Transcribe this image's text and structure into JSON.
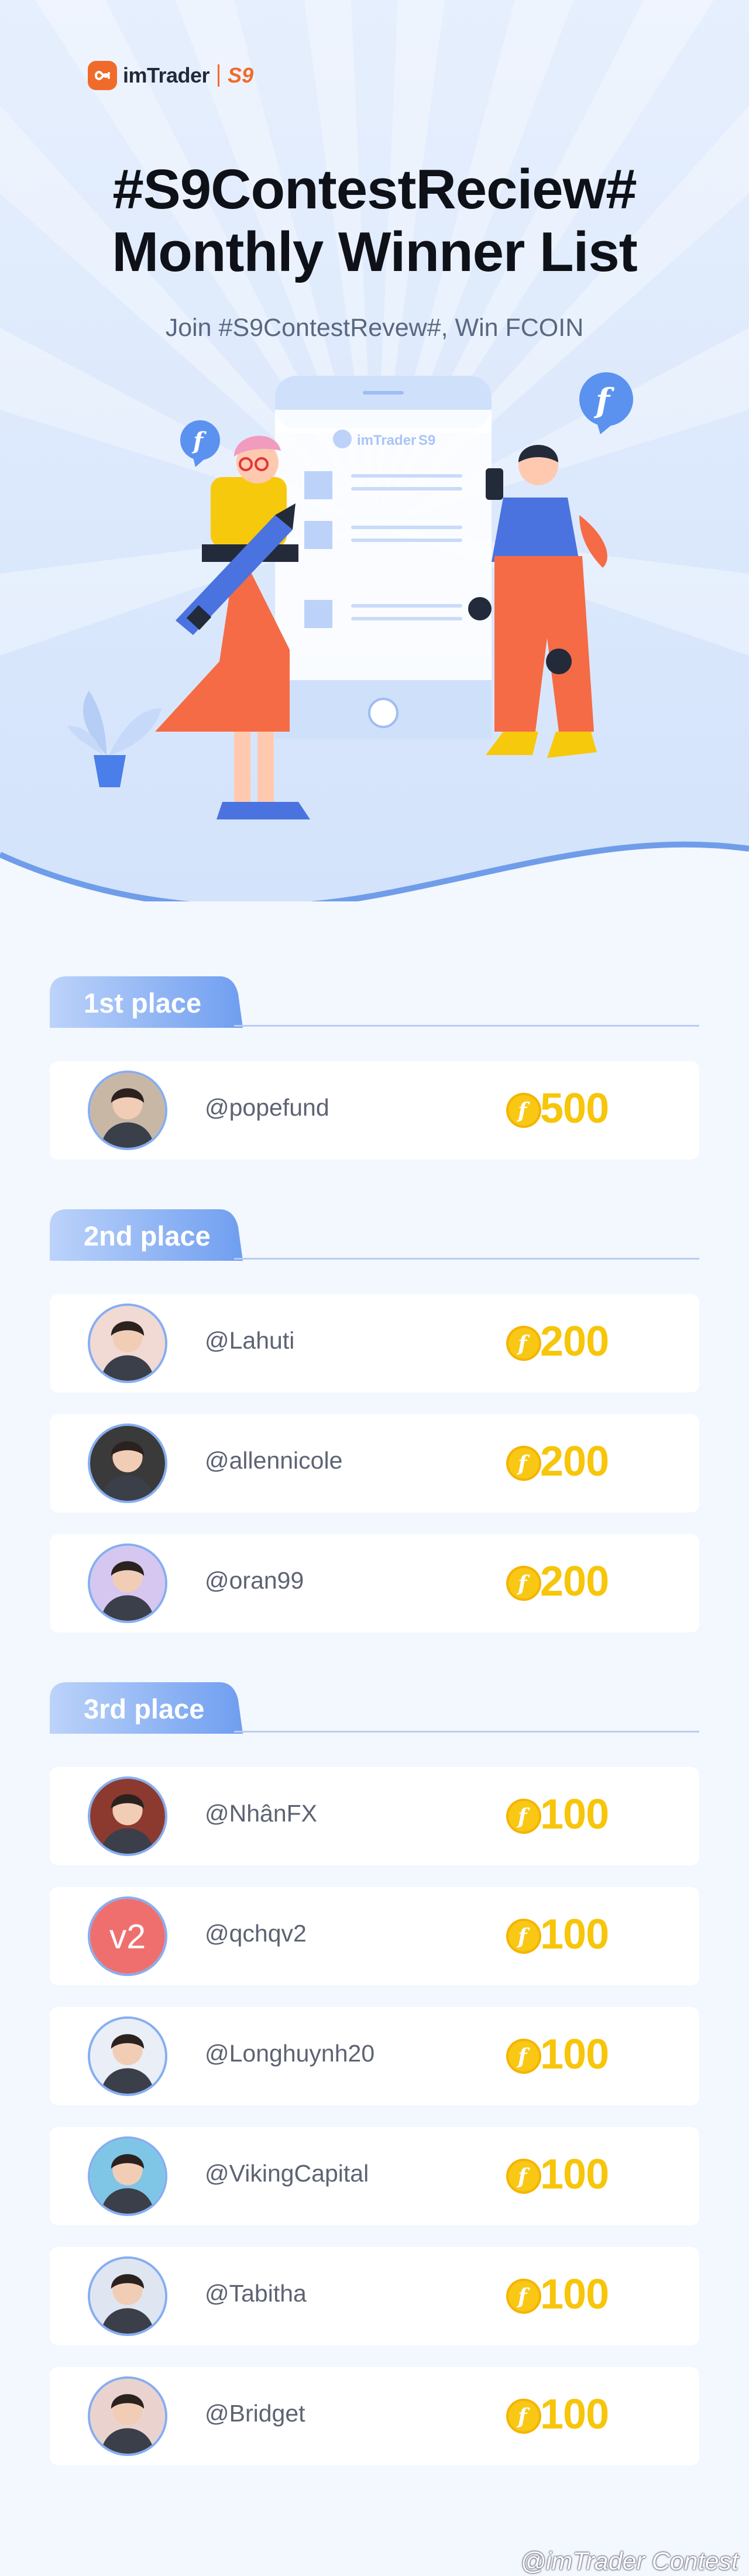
{
  "brand": {
    "name": "imTrader",
    "season": "S9",
    "accent": "#f06b2b"
  },
  "header": {
    "title_line1": "#S9ContestReciew#",
    "title_line2": "Monthly Winner List",
    "subtitle": "Join #S9ContestRevew#, Win FCOIN"
  },
  "illustration": {
    "phone_brand": "imTrader",
    "phone_season": "S9",
    "icons": [
      "fcoin-bubble-icon",
      "pencil-icon",
      "smartphone-icon",
      "plant-icon"
    ]
  },
  "colors": {
    "tab_blue": "#7ea8f3",
    "coin_gold": "#f7c50a",
    "card_bg": "#ffffff",
    "avatar_border": "#86aef0"
  },
  "sections": [
    {
      "label": "1st place",
      "winners": [
        {
          "username": "@popefund",
          "amount": "500",
          "avatar": "photo-avatar"
        }
      ]
    },
    {
      "label": "2nd place",
      "winners": [
        {
          "username": "@Lahuti",
          "amount": "200",
          "avatar": "photo-avatar"
        },
        {
          "username": "@allennicole",
          "amount": "200",
          "avatar": "photo-avatar"
        },
        {
          "username": "@oran99",
          "amount": "200",
          "avatar": "photo-avatar"
        }
      ]
    },
    {
      "label": "3rd place",
      "winners": [
        {
          "username": "@NhânFX",
          "amount": "100",
          "avatar": "photo-avatar"
        },
        {
          "username": "@qchqv2",
          "amount": "100",
          "avatar": "initials-avatar",
          "initials": "v2"
        },
        {
          "username": "@Longhuynh20",
          "amount": "100",
          "avatar": "photo-avatar"
        },
        {
          "username": "@VikingCapital",
          "amount": "100",
          "avatar": "photo-avatar"
        },
        {
          "username": "@Tabitha",
          "amount": "100",
          "avatar": "photo-avatar"
        },
        {
          "username": "@Bridget",
          "amount": "100",
          "avatar": "photo-avatar"
        }
      ]
    }
  ],
  "footer": {
    "watermark": "@imTrader Contest"
  }
}
